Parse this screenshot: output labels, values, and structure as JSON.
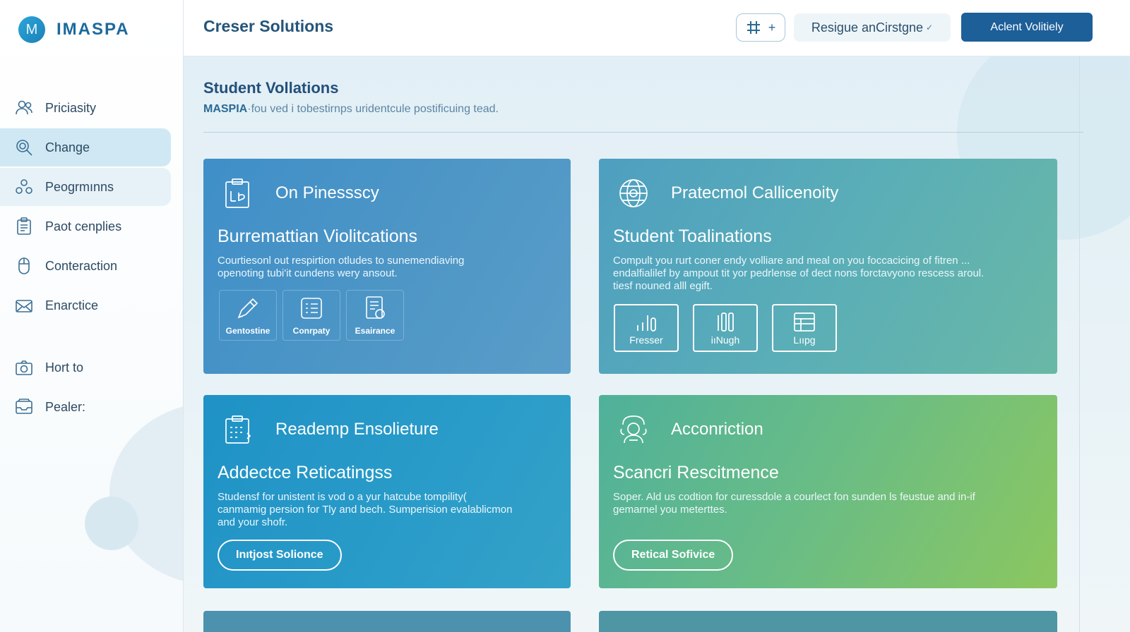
{
  "brand": {
    "logo_letter": "M",
    "name": "IMASPA"
  },
  "sidebar": {
    "items": [
      {
        "label": "Priciasity",
        "icon": "users-icon"
      },
      {
        "label": "Change",
        "icon": "search-icon"
      },
      {
        "label": "Peogrmınns",
        "icon": "group-icon"
      },
      {
        "label": "Paot cenplies",
        "icon": "clipboard-icon"
      },
      {
        "label": "Conteraction",
        "icon": "mouse-icon"
      },
      {
        "label": "Enarctice",
        "icon": "envelope-icon"
      },
      {
        "label": "Hort to",
        "icon": "camera-icon"
      },
      {
        "label": "Pealer:",
        "icon": "inbox-icon"
      }
    ]
  },
  "header": {
    "title": "Creser Solutions",
    "icon_button_plus": "+",
    "select_label": "Resigue anCirstgne",
    "select_chevron": "✓",
    "primary_button": "Aclent Volitiely"
  },
  "main": {
    "title": "Student Vollations",
    "subtitle_brand": "MASPIA",
    "subtitle": "·fou ved i tobestirnps uridentcule postificuing tead."
  },
  "cards": {
    "c1": {
      "head_title": "On Pinessscy",
      "title": "Burremattian Violitcations",
      "desc_1": "Courtiesonl out respirtion otludes to sunemendiaving",
      "desc_2": "openoting tubi'it cundens wery ansout.",
      "tiles": [
        "Gentostine",
        "Conrpaty",
        "Esairance"
      ]
    },
    "c2": {
      "head_title": "Pratecmol Callicenoity",
      "title": "Student Toalinations",
      "desc_1": "Compult you rurt coner endy volliare and meal on you foccacicing of fitren ...",
      "desc_2": "endalfialilef by ampout tit yor pedrlense of dect nons forctavyono rescess aroul.",
      "desc_3": "tiesf nouned alll egift.",
      "tiles": [
        "Fresser",
        "iıNugh",
        "Lııpg"
      ]
    },
    "c3": {
      "head_title": "Reademp Ensolieture",
      "title": "Addectce Reticatingss",
      "desc_1": "Studensf for unistent is vod o a yur hatcube tompility(",
      "desc_2": "canmamig persion for Tly and bech. Sumperision evalablicmon",
      "desc_3": "and your shofr.",
      "button": "Inıtjost Solionce"
    },
    "c4": {
      "head_title": "Acconriction",
      "title": "Scancri Rescitmence",
      "desc_1": "Soper. Ald us codtion for curessdole a courlect fon sunden ls feustue and in-if",
      "desc_2": "gemarnel you meterttes.",
      "button": "Retical Sofivice"
    }
  },
  "colors": {
    "primary": "#1c5f99",
    "nav_active": "#cfe8f4",
    "card_blue": "#3f8fc8",
    "card_teal": "#5aaeb7",
    "card_cyan": "#1f92c6",
    "card_green": "#8cc75f"
  }
}
